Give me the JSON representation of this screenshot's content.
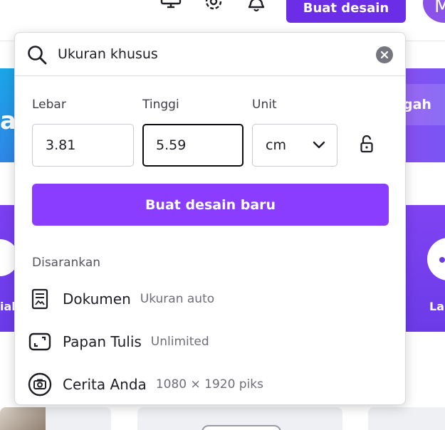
{
  "topbar": {
    "create_button_label": "Buat desain",
    "avatar_initial": "M"
  },
  "background": {
    "banner_left_text": "a",
    "banner_right_text": "gah",
    "card_left_text": "ial",
    "card_right_text": "La"
  },
  "panel": {
    "search": {
      "value": "Ukuran khusus",
      "placeholder": "Ukuran khusus"
    },
    "width": {
      "label": "Lebar",
      "value": "3.81"
    },
    "height": {
      "label": "Tinggi",
      "value": "5.59"
    },
    "unit": {
      "label": "Unit",
      "value": "cm"
    },
    "create_button_label": "Buat desain baru",
    "suggested": {
      "title": "Disarankan",
      "items": [
        {
          "name": "Dokumen",
          "meta": "Ukuran auto",
          "icon": "document-icon"
        },
        {
          "name": "Papan Tulis",
          "meta": "Unlimited",
          "icon": "whiteboard-icon"
        },
        {
          "name": "Cerita Anda",
          "meta": "1080 × 1920 piks",
          "icon": "camera-icon"
        }
      ]
    }
  },
  "colors": {
    "accent": "#8b3dff",
    "top_button": "#6b2ee6",
    "text": "#1d1d24"
  }
}
